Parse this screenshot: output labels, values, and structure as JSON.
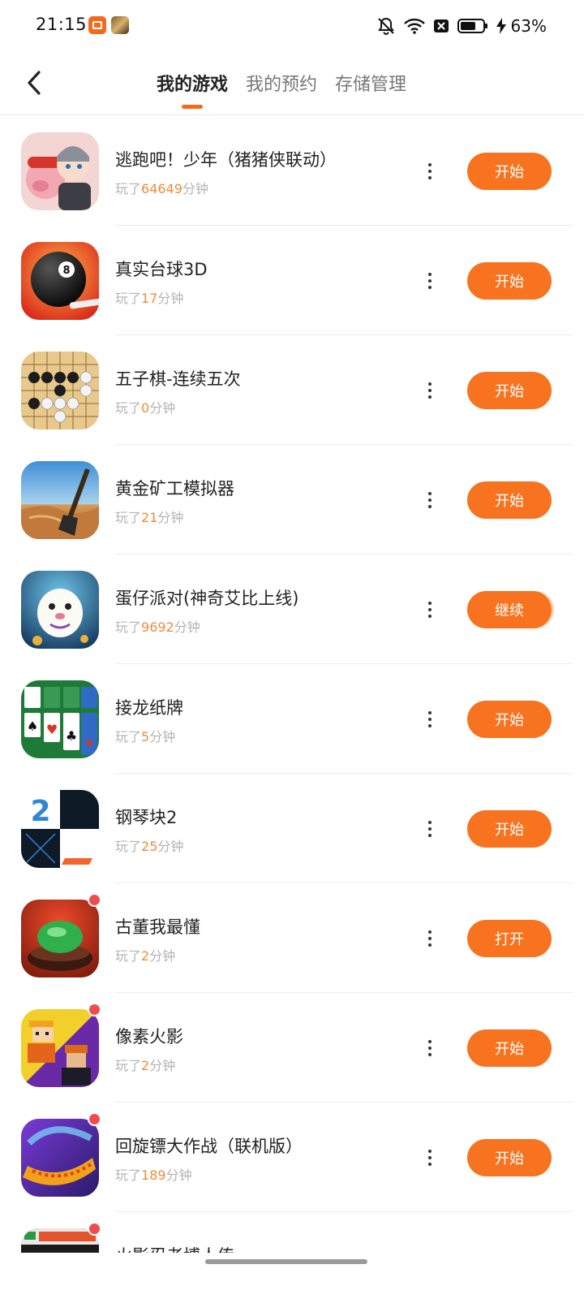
{
  "status_bar": {
    "time": "21:15",
    "battery_percent": "63%",
    "icons": [
      "app-notification-icon-1",
      "app-notification-icon-2",
      "mute-bell-icon",
      "wifi-icon",
      "no-sim-icon",
      "battery-icon",
      "charging-bolt-icon"
    ]
  },
  "header": {
    "back_icon": "chevron-left-icon",
    "tabs": [
      {
        "label": "我的游戏",
        "active": true
      },
      {
        "label": "我的预约",
        "active": false
      },
      {
        "label": "存储管理",
        "active": false
      }
    ]
  },
  "colors": {
    "accent": "#f7731f",
    "minutes_highlight": "#f08a3a",
    "badge": "#f24b4b"
  },
  "games": [
    {
      "title": "逃跑吧！少年（猪猪侠联动）",
      "played_prefix": "玩了",
      "minutes": "64649",
      "played_suffix": "分钟",
      "action": "开始",
      "badge": false,
      "icon": "escape-boy-icon"
    },
    {
      "title": "真实台球3D",
      "played_prefix": "玩了",
      "minutes": "17",
      "played_suffix": "分钟",
      "action": "开始",
      "badge": false,
      "icon": "billiards-8-ball-icon"
    },
    {
      "title": "五子棋-连续五次",
      "played_prefix": "玩了",
      "minutes": "0",
      "played_suffix": "分钟",
      "action": "开始",
      "badge": false,
      "icon": "gomoku-board-icon"
    },
    {
      "title": "黄金矿工模拟器",
      "played_prefix": "玩了",
      "minutes": "21",
      "played_suffix": "分钟",
      "action": "开始",
      "badge": false,
      "icon": "gold-miner-shovel-icon"
    },
    {
      "title": "蛋仔派对(神奇艾比上线)",
      "played_prefix": "玩了",
      "minutes": "9692",
      "played_suffix": "分钟",
      "action": "继续",
      "badge": false,
      "icon": "eggy-party-icon"
    },
    {
      "title": "接龙纸牌",
      "played_prefix": "玩了",
      "minutes": "5",
      "played_suffix": "分钟",
      "action": "开始",
      "badge": false,
      "icon": "solitaire-cards-icon"
    },
    {
      "title": "钢琴块2",
      "played_prefix": "玩了",
      "minutes": "25",
      "played_suffix": "分钟",
      "action": "开始",
      "badge": false,
      "icon": "piano-tiles-2-icon"
    },
    {
      "title": "古董我最懂",
      "played_prefix": "玩了",
      "minutes": "2",
      "played_suffix": "分钟",
      "action": "打开",
      "badge": true,
      "icon": "jade-antique-icon"
    },
    {
      "title": "像素火影",
      "played_prefix": "玩了",
      "minutes": "2",
      "played_suffix": "分钟",
      "action": "开始",
      "badge": true,
      "icon": "pixel-ninja-icon"
    },
    {
      "title": "回旋镖大作战（联机版）",
      "played_prefix": "玩了",
      "minutes": "189",
      "played_suffix": "分钟",
      "action": "开始",
      "badge": true,
      "icon": "boomerang-icon"
    },
    {
      "title": "火影忍者博人传",
      "played_prefix": "",
      "minutes": "",
      "played_suffix": "",
      "action": "",
      "badge": true,
      "icon": "shinobi-striker-icon"
    }
  ]
}
